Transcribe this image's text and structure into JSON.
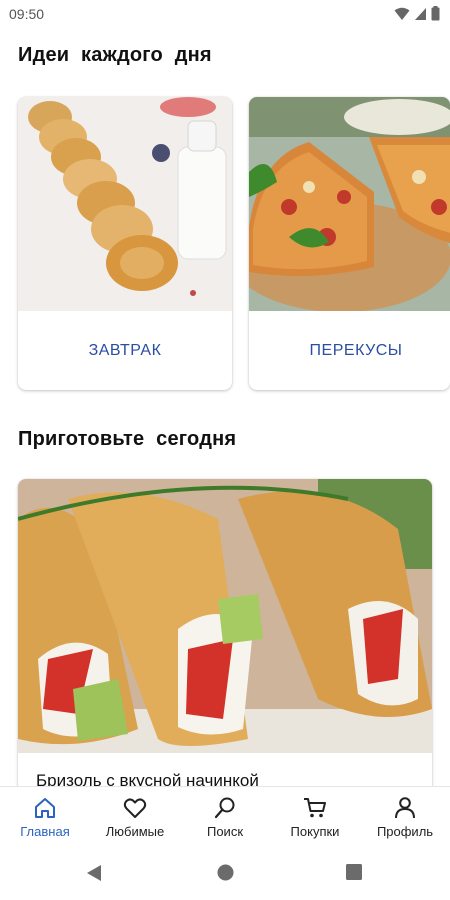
{
  "status_bar": {
    "time": "09:50",
    "icons": [
      "wifi-icon",
      "signal-icon",
      "battery-icon"
    ]
  },
  "ideas_section": {
    "title": "Идеи  каждого  дня",
    "cards": [
      {
        "label": "ЗАВТРАК",
        "image": "syrniki-breakfast-photo"
      },
      {
        "label": "ПЕРЕКУСЫ",
        "image": "pizza-snacks-photo"
      }
    ]
  },
  "cook_section": {
    "title": "Приготовьте  сегодня",
    "recipe": {
      "title": "Бризоль с вкусной начинкой",
      "image": "omelette-rolls-photo"
    }
  },
  "bottom_nav": {
    "items": [
      {
        "label": "Главная",
        "icon": "home-icon",
        "active": true
      },
      {
        "label": "Любимые",
        "icon": "heart-icon",
        "active": false
      },
      {
        "label": "Поиск",
        "icon": "search-icon",
        "active": false
      },
      {
        "label": "Покупки",
        "icon": "cart-icon",
        "active": false
      },
      {
        "label": "Профиль",
        "icon": "person-icon",
        "active": false
      }
    ]
  },
  "colors": {
    "accent": "#2b63c0",
    "card_label": "#2b4fa0"
  },
  "system_nav": [
    "back-icon",
    "home-circle-icon",
    "recents-icon"
  ]
}
